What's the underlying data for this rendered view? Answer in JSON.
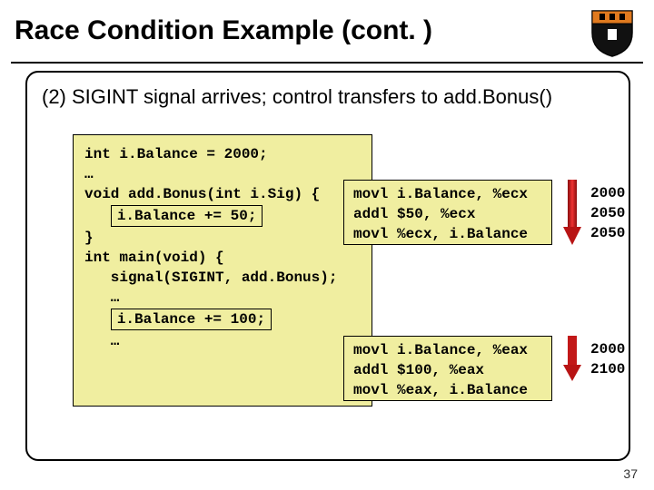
{
  "title": "Race Condition Example (cont. )",
  "lead": "(2) SIGINT signal arrives; control transfers to add.Bonus()",
  "code": {
    "l1": "int i.Balance = 2000;",
    "l2": "…",
    "l3": "void add.Bonus(int i.Sig) {",
    "l4": "i.Balance += 50;",
    "l5": "}",
    "l6": "int main(void) {",
    "l7": "   signal(SIGINT, add.Bonus);",
    "l8": "   …",
    "l9": "i.Balance += 100;",
    "l10": "   …"
  },
  "asm1": {
    "a": "movl i.Balance, %ecx",
    "b": "addl $50, %ecx",
    "c": "movl %ecx, i.Balance"
  },
  "asm2": {
    "a": "movl i.Balance, %eax",
    "b": "addl $100, %eax",
    "c": "movl %eax, i.Balance"
  },
  "vals1": {
    "a": "2000",
    "b": "2050",
    "c": "2050"
  },
  "vals2": {
    "a": "2000",
    "b": "2100"
  },
  "pagenum": "37"
}
